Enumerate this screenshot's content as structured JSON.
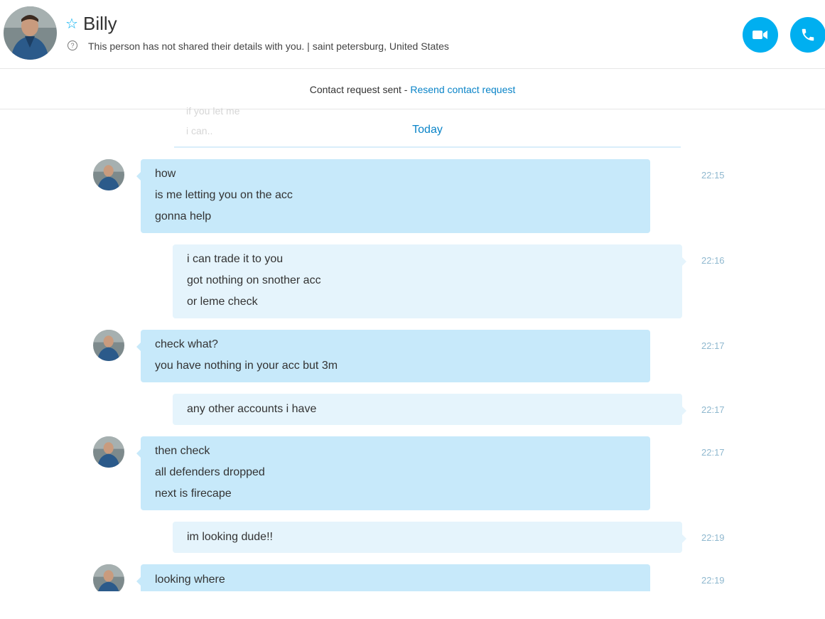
{
  "contact": {
    "name": "Billy",
    "status": "This person has not shared their details with you.  |  saint petersburg, United States"
  },
  "actions": {
    "video_call": "video-camera-icon",
    "audio_call": "phone-icon"
  },
  "banner": {
    "text": "Contact request sent - ",
    "link": "Resend contact request"
  },
  "faded_history": [
    "if you let me",
    "i can.."
  ],
  "divider": "Today",
  "colors": {
    "accent": "#00aff0",
    "incoming_bubble": "#c7e9fa",
    "outgoing_bubble": "#e5f4fc",
    "link": "#0a84c8"
  },
  "messages": [
    {
      "from": "them",
      "time": "22:15",
      "lines": [
        "how",
        "is me letting you on the acc",
        "gonna help"
      ]
    },
    {
      "from": "me",
      "time": "22:16",
      "lines": [
        "i can trade it to you",
        "got nothing on snother acc",
        "or leme check"
      ]
    },
    {
      "from": "them",
      "time": "22:17",
      "lines": [
        "check what?",
        "you have nothing in your acc but 3m"
      ]
    },
    {
      "from": "me",
      "time": "22:17",
      "lines": [
        "any other accounts i have"
      ]
    },
    {
      "from": "them",
      "time": "22:17",
      "lines": [
        "then check",
        "all defenders dropped",
        "next is firecape"
      ]
    },
    {
      "from": "me",
      "time": "22:19",
      "lines": [
        "im looking dude!!"
      ]
    },
    {
      "from": "them",
      "time": "22:19",
      "lines": [
        "looking where"
      ]
    }
  ]
}
